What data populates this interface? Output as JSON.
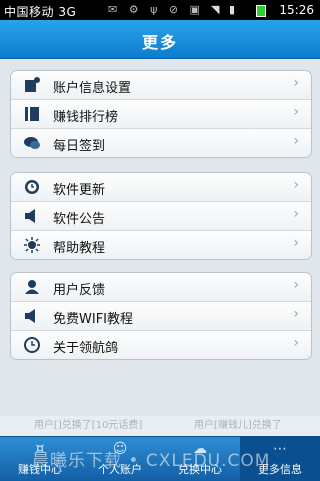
{
  "status_bar": {
    "carrier": "中国移动 3G",
    "time": "15:26"
  },
  "header": {
    "title": "更多"
  },
  "groups": [
    {
      "items": [
        {
          "label": "账户信息设置",
          "icon": "account-settings-icon"
        },
        {
          "label": "赚钱排行榜",
          "icon": "ranking-icon"
        },
        {
          "label": "每日签到",
          "icon": "chat-icon"
        }
      ]
    },
    {
      "items": [
        {
          "label": "软件更新",
          "icon": "update-clock-icon"
        },
        {
          "label": "软件公告",
          "icon": "speaker-icon"
        },
        {
          "label": "帮助教程",
          "icon": "sun-icon"
        }
      ]
    },
    {
      "items": [
        {
          "label": "用户反馈",
          "icon": "user-icon"
        },
        {
          "label": "免费WIFI教程",
          "icon": "speaker-icon"
        },
        {
          "label": "关于领航鸽",
          "icon": "clock-icon"
        }
      ]
    }
  ],
  "ticker": {
    "text1": "用户[]兑换了[10元话费]",
    "text2": "用户[赚钱儿]兑换了"
  },
  "bottom_nav": [
    {
      "label": "赚钱中心",
      "icon": "coin-icon",
      "active": false
    },
    {
      "label": "个人账户",
      "icon": "person-icon",
      "active": false
    },
    {
      "label": "兑换中心",
      "icon": "gift-icon",
      "active": false
    },
    {
      "label": "更多信息",
      "icon": "more-dots-icon",
      "active": true
    }
  ],
  "watermark": "晨曦乐下载 • CXLEDU.COM"
}
